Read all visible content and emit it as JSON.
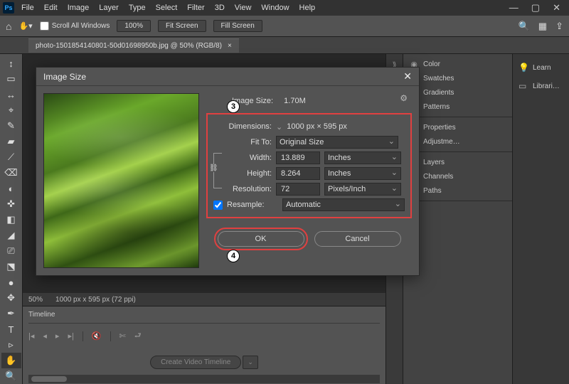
{
  "app": {
    "logo": "Ps"
  },
  "menu": [
    "File",
    "Edit",
    "Image",
    "Layer",
    "Type",
    "Select",
    "Filter",
    "3D",
    "View",
    "Window",
    "Help"
  ],
  "winctrls": {
    "min": "—",
    "max": "▢",
    "close": "✕"
  },
  "optbar": {
    "scroll_all": "Scroll All Windows",
    "zoom": "100%",
    "fit": "Fit Screen",
    "fill": "Fill Screen"
  },
  "tab": {
    "label": "photo-1501854140801-50d01698950b.jpg @ 50% (RGB/8)",
    "close": "×"
  },
  "tools": [
    "↕",
    "▭",
    "↔",
    "⌖",
    "✎",
    "▰",
    "⟋",
    "⌫",
    "◐",
    "✜",
    "◧",
    "◢",
    "⎚",
    "⬔",
    "●",
    "✥",
    "✒",
    "T",
    "▹",
    "▢",
    "✋",
    "🔍"
  ],
  "status": {
    "zoom": "50%",
    "dims": "1000 px x 595 px (72 ppi)"
  },
  "timeline": {
    "title": "Timeline",
    "btn": "Create Video Timeline",
    "dd": "⌄"
  },
  "panels": {
    "color": "Color",
    "swatches": "Swatches",
    "gradients": "Gradients",
    "patterns": "Patterns",
    "properties": "Properties",
    "adjust": "Adjustme…",
    "layers": "Layers",
    "channels": "Channels",
    "paths": "Paths"
  },
  "sidetabs": {
    "learn": "Learn",
    "libraries": "Librari…"
  },
  "dialog": {
    "title": "Image Size",
    "size_label": "Image Size:",
    "size_val": "1.70M",
    "dim_label": "Dimensions:",
    "dim_val": "1000 px × 595 px",
    "dim_dd": "⌄",
    "fit_label": "Fit To:",
    "fit_val": "Original Size",
    "width_label": "Width:",
    "width_val": "13.889",
    "width_unit": "Inches",
    "height_label": "Height:",
    "height_val": "8.264",
    "height_unit": "Inches",
    "res_label": "Resolution:",
    "res_val": "72",
    "res_unit": "Pixels/Inch",
    "resample_label": "Resample:",
    "resample_val": "Automatic",
    "ok": "OK",
    "cancel": "Cancel",
    "gear": "⚙",
    "link": "⛓"
  },
  "callouts": {
    "c3": "3",
    "c4": "4"
  }
}
